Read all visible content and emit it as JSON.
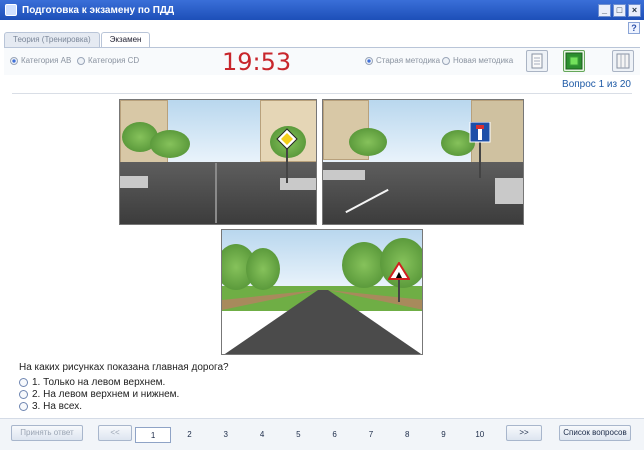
{
  "window": {
    "title": "Подготовка к экзамену по ПДД",
    "help": "?",
    "controls": [
      "_",
      "□",
      "×"
    ]
  },
  "tabs": [
    {
      "label": "Теория (Тренировка)",
      "active": false
    },
    {
      "label": "Экзамен",
      "active": true
    }
  ],
  "toolbar": {
    "categories": [
      {
        "label": "Категория АВ",
        "selected": true
      },
      {
        "label": "Категория CD",
        "selected": false
      }
    ],
    "timer": "19:53",
    "methods": [
      {
        "label": "Старая методика",
        "selected": true
      },
      {
        "label": "Новая методика",
        "selected": false
      }
    ],
    "icons": [
      "document-icon",
      "green-square-icon",
      "list-icon"
    ]
  },
  "question_counter": "Вопрос 1 из 20",
  "question": {
    "text": "На каких рисунках показана главная дорога?",
    "answers": [
      "1. Только на левом верхнем.",
      "2. На левом верхнем и нижнем.",
      "3. На всех."
    ]
  },
  "bottom": {
    "submit_label": "Принять ответ",
    "prev_label": "<<",
    "next_label": ">>",
    "list_label": "Список вопросов",
    "pages": [
      "1",
      "2",
      "3",
      "4",
      "5",
      "6",
      "7",
      "8",
      "9",
      "10"
    ],
    "current_page": "1"
  },
  "colors": {
    "timer": "#c8262c",
    "accent": "#1e5aa6",
    "titlebar": "#2a5cc8"
  }
}
